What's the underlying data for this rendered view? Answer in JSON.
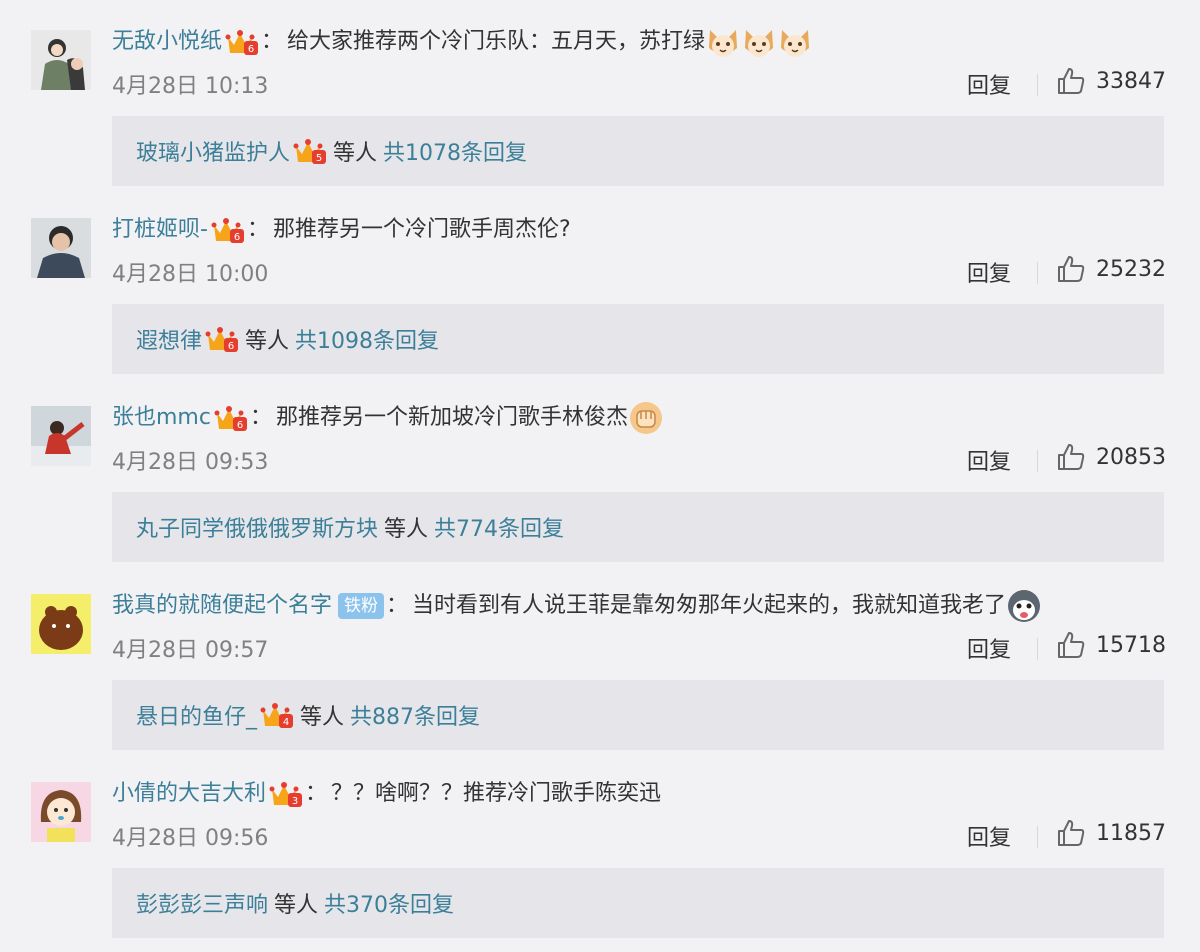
{
  "ui": {
    "reply_label": "回复",
    "others_label": "等人",
    "link_color": "#3c7f99"
  },
  "comments": [
    {
      "username": "无敌小悦纸",
      "text": "给大家推荐两个冷门乐队：五月天，苏打绿",
      "emoji": "cat-emoji x3",
      "time": "4月28日 10:13",
      "likes": "33847",
      "reply_user": "玻璃小猪监护人",
      "reply_total": "共1078条回复"
    },
    {
      "username": "打桩姬呗-",
      "text": "那推荐另一个冷门歌手周杰伦?",
      "time": "4月28日 10:00",
      "likes": "25232",
      "reply_user": "遐想律",
      "reply_total": "共1098条回复"
    },
    {
      "username": "张也mmc",
      "text": "那推荐另一个新加坡冷门歌手林俊杰",
      "emoji": "fist-emoji",
      "time": "4月28日 09:53",
      "likes": "20853",
      "reply_user": "丸子同学俄俄俄罗斯方块",
      "reply_total": "共774条回复"
    },
    {
      "username": "我真的就随便起个名字",
      "badge": "铁粉",
      "text": "当时看到有人说王菲是靠匆匆那年火起来的，我就知道我老了",
      "emoji": "husky-emoji",
      "time": "4月28日 09:57",
      "likes": "15718",
      "reply_user": "悬日的鱼仔_",
      "reply_total": "共887条回复"
    },
    {
      "username": "小倩的大吉大利",
      "text": "？？啥啊？？推荐冷门歌手陈奕迅",
      "time": "4月28日 09:56",
      "likes": "11857",
      "reply_user": "彭彭彭三声响",
      "reply_total": "共370条回复"
    }
  ]
}
